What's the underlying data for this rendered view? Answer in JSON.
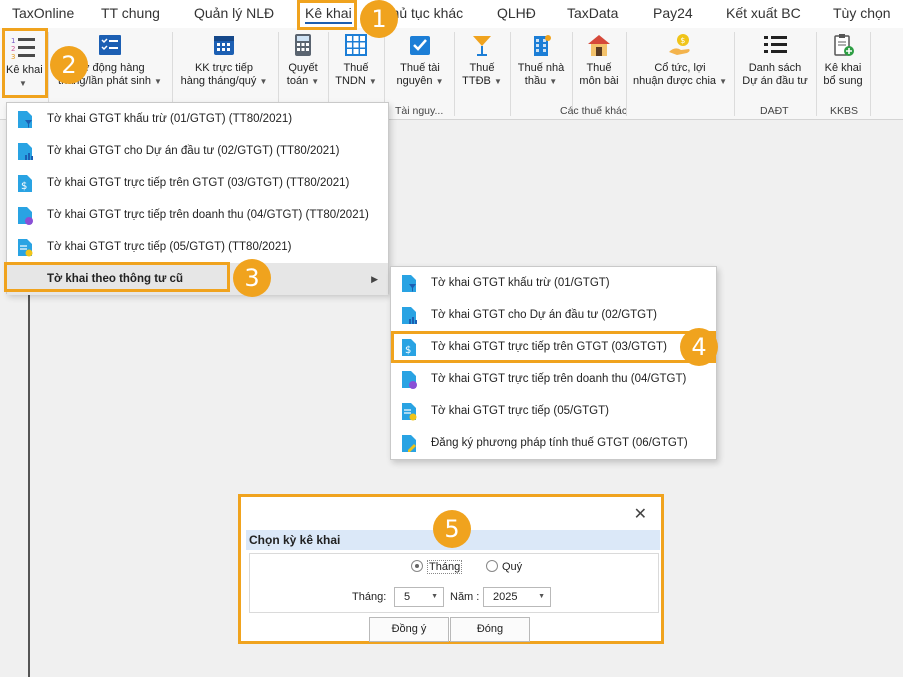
{
  "menubar": {
    "tabs": [
      "TaxOnline",
      "TT chung",
      "Quản lý NLĐ",
      "Kê khai",
      "Thủ tục khác",
      "QLHĐ",
      "TaxData",
      "Pay24",
      "Kết xuất BC",
      "Tùy chọn"
    ],
    "active": "Kê khai"
  },
  "ribbon": {
    "kekhai": "Kê khai",
    "tudong_l1": "Tự động hàng",
    "tudong_l2": "tháng/lần phát sinh",
    "kk_l1": "KK trực tiếp",
    "kk_l2": "hàng tháng/quý",
    "quyettoan_l1": "Quyết",
    "quyettoan_l2": "toán",
    "tndn_l1": "Thuế",
    "tndn_l2": "TNDN",
    "tainguyen_l1": "Thuế tài",
    "tainguyen_l2": "nguyên",
    "ttdb_l1": "Thuế",
    "ttdb_l2": "TTĐB",
    "nhathau_l1": "Thuế nhà",
    "nhathau_l2": "thầu",
    "monbai_l1": "Thuế",
    "monbai_l2": "môn bài",
    "cotuc_l1": "Cổ tức, lợi",
    "cotuc_l2": "nhuận được chia",
    "danhsach_l1": "Danh sách",
    "danhsach_l2": "Dự án đầu tư",
    "bosung_l1": "Kê khai",
    "bosung_l2": "bổ sung",
    "group_tainguyen": "Tài nguy...",
    "group_khac": "Các thuế khác",
    "group_dadt": "DAĐT",
    "group_kkbs": "KKBS"
  },
  "menu1": {
    "items": [
      "Tờ khai GTGT khấu trừ (01/GTGT) (TT80/2021)",
      "Tờ khai GTGT cho Dự án đầu tư (02/GTGT) (TT80/2021)",
      "Tờ khai GTGT trực tiếp trên GTGT (03/GTGT) (TT80/2021)",
      "Tờ khai GTGT trực tiếp trên doanh thu (04/GTGT) (TT80/2021)",
      "Tờ khai GTGT trực tiếp (05/GTGT) (TT80/2021)"
    ],
    "submenu_label": "Tờ khai theo thông tư cũ"
  },
  "menu2": {
    "items": [
      "Tờ khai GTGT khấu trừ (01/GTGT)",
      "Tờ khai GTGT cho Dự án đầu tư (02/GTGT)",
      "Tờ khai GTGT trực tiếp trên GTGT (03/GTGT)",
      "Tờ khai GTGT trực tiếp trên doanh thu (04/GTGT)",
      "Tờ khai GTGT trực tiếp (05/GTGT)",
      "Đăng ký phương pháp tính thuế GTGT (06/GTGT)"
    ]
  },
  "dialog": {
    "close": "✕",
    "title": "Chọn kỳ kê khai",
    "radio_month": "Tháng",
    "radio_quarter": "Quý",
    "month_label": "Tháng:",
    "month_value": "5",
    "year_label": "Năm :",
    "year_value": "2025",
    "ok": "Đồng ý",
    "cancel": "Đóng"
  },
  "steps": [
    "1",
    "2",
    "3",
    "4",
    "5"
  ],
  "colors": {
    "accent": "#f0a31e",
    "brand": "#1c5fb3",
    "highlight_bg": "#dbe8f8"
  }
}
